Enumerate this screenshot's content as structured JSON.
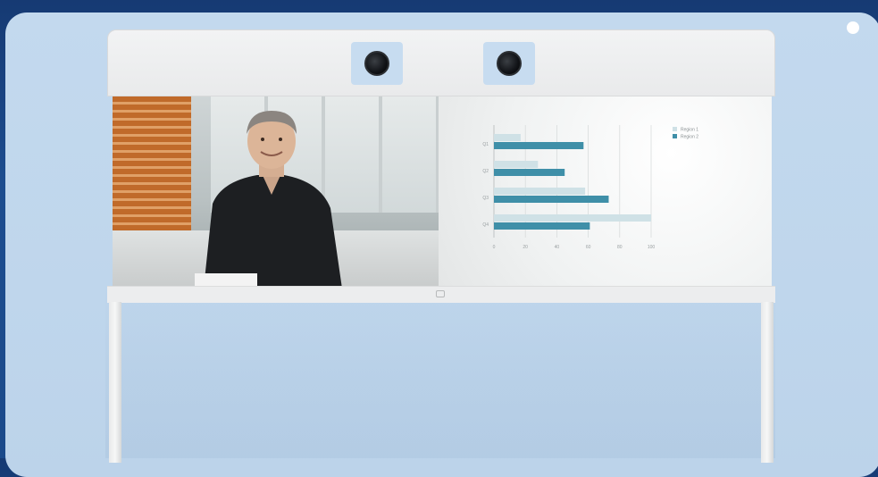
{
  "colors": {
    "background": "#1b4a8a",
    "panel": "#bfd6ec",
    "bezel": "#eeeff0",
    "region1": "#cfe1e6",
    "region2": "#3f8fa8"
  },
  "icons": {
    "camera_left": "camera-lens-icon",
    "camera_right": "camera-lens-icon",
    "home": "home-button-icon"
  },
  "chart_data": {
    "type": "bar",
    "orientation": "horizontal",
    "categories": [
      "Q1",
      "Q2",
      "Q3",
      "Q4"
    ],
    "series": [
      {
        "name": "Region 1",
        "values": [
          17,
          28,
          58,
          100
        ]
      },
      {
        "name": "Region 2",
        "values": [
          57,
          45,
          73,
          61
        ]
      }
    ],
    "xlim": [
      0,
      100
    ],
    "xticks": [
      "0",
      "20",
      "40",
      "60",
      "80",
      "100"
    ],
    "legend_position": "top-right",
    "grid": true
  }
}
